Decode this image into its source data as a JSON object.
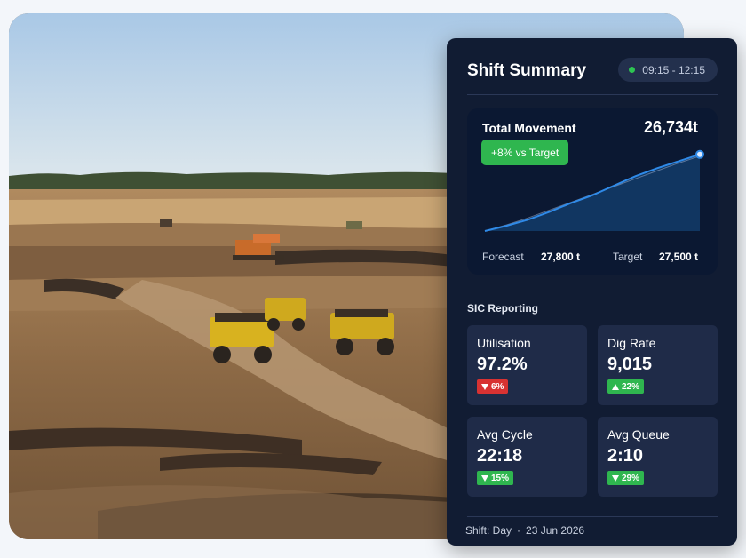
{
  "panel": {
    "title": "Shift Summary",
    "time_range": "09:15 - 12:15",
    "status_color": "#2dc552"
  },
  "total_movement": {
    "label": "Total Movement",
    "value": "26,734t",
    "badge": "+8% vs Target",
    "forecast_label": "Forecast",
    "forecast_value": "27,800 t",
    "target_label": "Target",
    "target_value": "27,500 t"
  },
  "sic": {
    "title": "SIC Reporting",
    "kpis": [
      {
        "label": "Utilisation",
        "value": "97.2%",
        "delta": "6%",
        "direction": "down"
      },
      {
        "label": "Dig Rate",
        "value": "9,015",
        "delta": "22%",
        "direction": "up"
      },
      {
        "label": "Avg Cycle",
        "value": "22:18",
        "delta": "15%",
        "direction": "down-good"
      },
      {
        "label": "Avg Queue",
        "value": "2:10",
        "delta": "29%",
        "direction": "down-good"
      }
    ]
  },
  "footer": {
    "shift": "Shift: Day",
    "separator": "·",
    "date": "23 Jun 2026"
  },
  "colors": {
    "panel_bg": "#111c33",
    "card_bg": "#1f2b48",
    "positive": "#2fb64f",
    "negative": "#d83232",
    "line": "#2f8ae8"
  },
  "chart_data": {
    "type": "area",
    "title": "Total Movement",
    "x": [
      0,
      1,
      2,
      3,
      4,
      5,
      6,
      7,
      8,
      9,
      10
    ],
    "series": [
      {
        "values": [
          0,
          6,
          13,
          22,
          32,
          41,
          52,
          63,
          72,
          80,
          88
        ]
      },
      {
        "values": [
          0,
          7,
          15,
          24,
          33,
          42,
          51,
          60,
          69,
          78,
          86
        ]
      }
    ],
    "ylim": [
      0,
      100
    ],
    "grid": false
  }
}
